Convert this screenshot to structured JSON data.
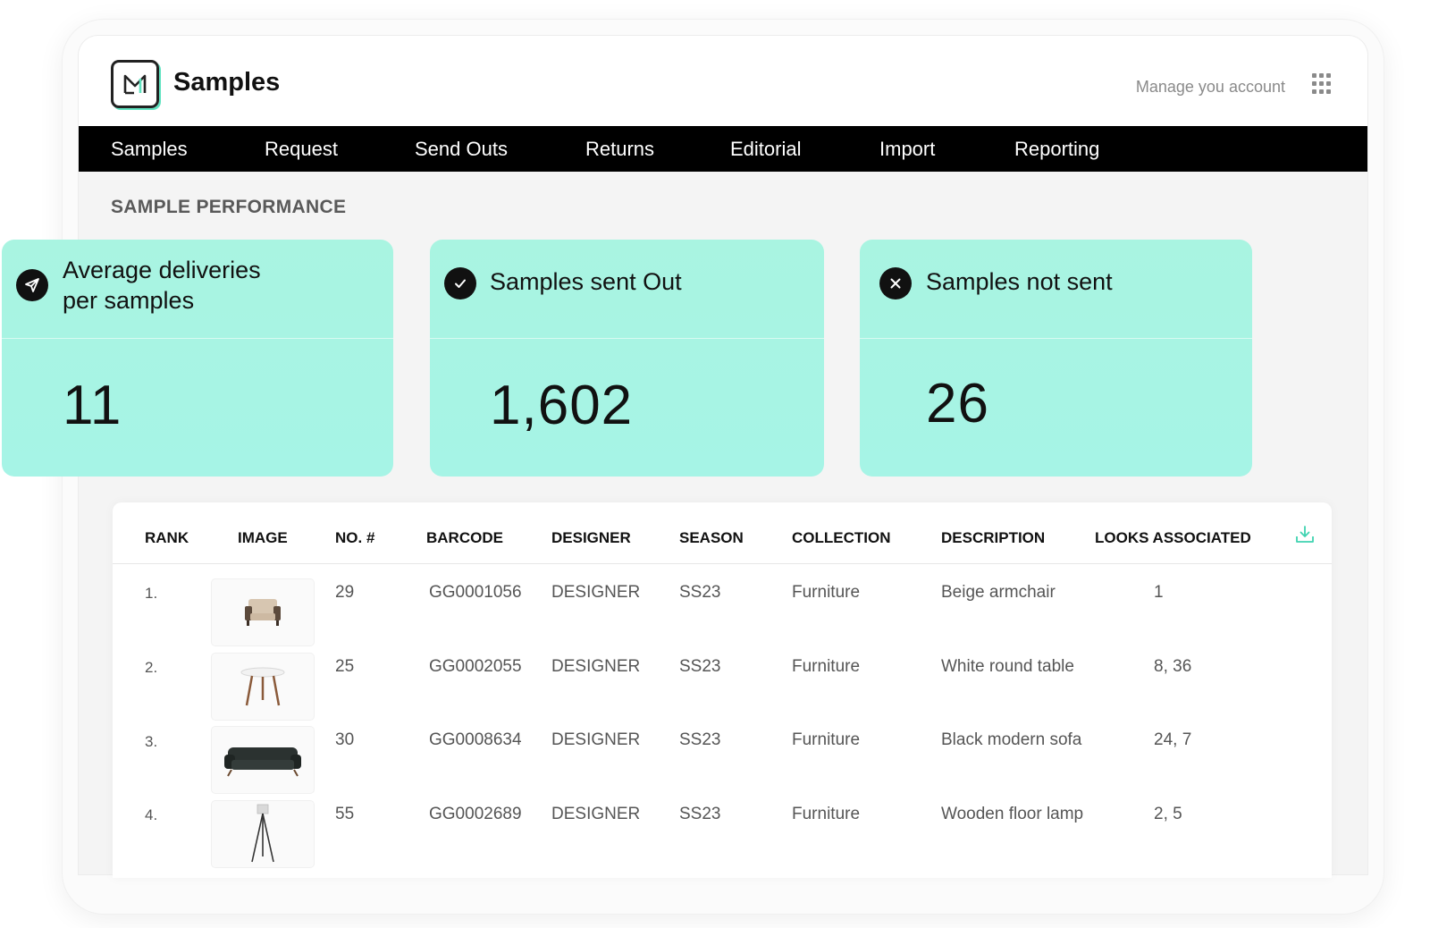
{
  "app": {
    "title": "Samples",
    "account_link": "Manage you account"
  },
  "nav": {
    "items": [
      "Samples",
      "Request",
      "Send Outs",
      "Returns",
      "Editorial",
      "Import",
      "Reporting"
    ]
  },
  "section_title": "SAMPLE PERFORMANCE",
  "stats": [
    {
      "label_line1": "Average deliveries",
      "label_line2": "per samples",
      "value": "11",
      "icon": "paper-plane-icon"
    },
    {
      "label": "Samples sent Out",
      "value": "1,602",
      "icon": "check-circle-icon"
    },
    {
      "label": "Samples not sent",
      "value": "26",
      "icon": "x-circle-icon"
    }
  ],
  "table": {
    "headers": [
      "RANK",
      "IMAGE",
      "NO. #",
      "BARCODE",
      "DESIGNER",
      "SEASON",
      "COLLECTION",
      "DESCRIPTION",
      "LOOKS ASSOCIATED"
    ],
    "rows": [
      {
        "rank": "1.",
        "image": "armchair",
        "no": "29",
        "barcode": "GG0001056",
        "designer": "DESIGNER",
        "season": "SS23",
        "collection": "Furniture",
        "description": "Beige armchair",
        "looks": "1"
      },
      {
        "rank": "2.",
        "image": "round-table",
        "no": "25",
        "barcode": "GG0002055",
        "designer": "DESIGNER",
        "season": "SS23",
        "collection": "Furniture",
        "description": "White round table",
        "looks": "8, 36"
      },
      {
        "rank": "3.",
        "image": "sofa",
        "no": "30",
        "barcode": "GG0008634",
        "designer": "DESIGNER",
        "season": "SS23",
        "collection": "Furniture",
        "description": "Black modern sofa",
        "looks": "24, 7"
      },
      {
        "rank": "4.",
        "image": "floor-lamp",
        "no": "55",
        "barcode": "GG0002689",
        "designer": "DESIGNER",
        "season": "SS23",
        "collection": "Furniture",
        "description": "Wooden floor lamp",
        "looks": "2, 5"
      }
    ]
  },
  "colors": {
    "accent": "#5fe3c0",
    "card_bg": "#a9f4e1",
    "nav_bg": "#000000"
  }
}
